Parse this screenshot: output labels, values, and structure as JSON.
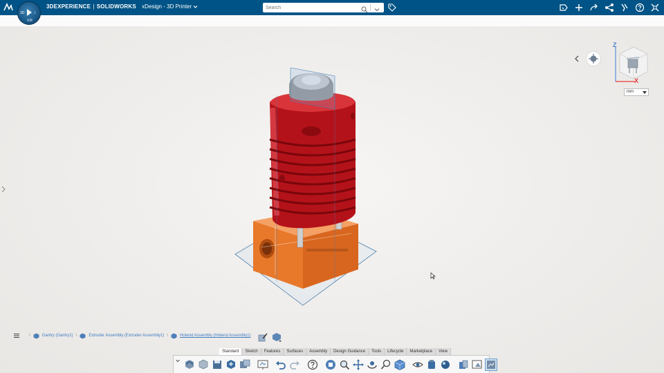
{
  "app": {
    "platform_name": "3DEXPERIENCE",
    "separator": "|",
    "product_name": "SOLIDWORKS",
    "app_name": "xDesign",
    "document_name": "3D Printer",
    "title_separator": "-"
  },
  "compass": {
    "north": "",
    "west": "3D",
    "south": "V.R",
    "east": "i"
  },
  "search": {
    "placeholder": "Search",
    "value": ""
  },
  "topbar_icons": [
    "share-annotation-icon",
    "add-icon",
    "forward-icon",
    "share-icon",
    "communities-icon",
    "help-icon",
    "tools-icon"
  ],
  "viewport": {
    "unit_value": "mm",
    "axis_z": "Z",
    "axis_x": "X"
  },
  "breadcrumb": {
    "items": [
      {
        "label": "Gantry (Gantry1)",
        "active": false
      },
      {
        "label": "Extruder Assembly (Extruder Assembly1)",
        "active": false
      },
      {
        "label": "Hotend Assembly (Hotend Assembly1)",
        "active": true
      }
    ]
  },
  "action_bar": {
    "tabs": [
      "Standard",
      "Sketch",
      "Features",
      "Surfaces",
      "Assembly",
      "Design Guidance",
      "Tools",
      "Lifecycle",
      "Marketplace",
      "View"
    ],
    "active_tab": "Standard",
    "tools": [
      "rebuild-icon",
      "part-icon",
      "save-icon",
      "save-all-icon",
      "save-as-icon",
      "whiteboard-icon",
      "undo-icon",
      "redo-icon",
      "help-icon",
      "view-orientation-icon",
      "zoom-to-fit-icon",
      "pan-icon",
      "rotate-icon",
      "zoom-icon",
      "display-style-icon",
      "hide-show-icon",
      "appearance-icon",
      "render-icon",
      "section-icon",
      "view-options-icon",
      "camera-icon",
      "ambient-occlusion-icon"
    ]
  },
  "colors": {
    "topbar": "#005386",
    "hotend_red": "#c8161d",
    "heater_block_orange": "#f07a2a",
    "link_blue": "#3f7cc0"
  }
}
